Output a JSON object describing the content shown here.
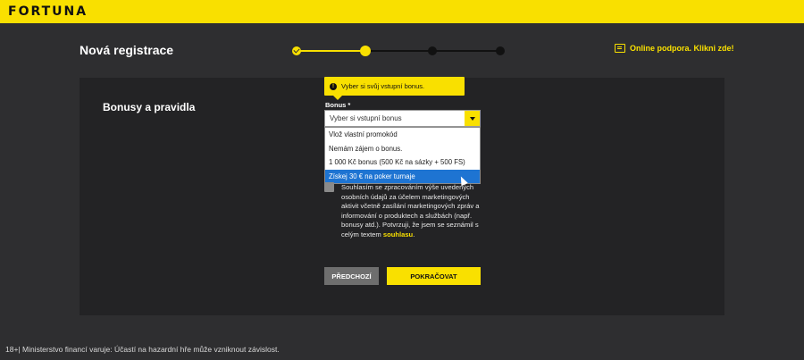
{
  "header": {
    "logo": "FORTUNA"
  },
  "page": {
    "title": "Nová registrace"
  },
  "stepper": {
    "total_steps": 4,
    "completed_steps": 1,
    "current_step": 2
  },
  "support": {
    "label": "Online podpora. Klikni zde!",
    "icon": "chat-icon"
  },
  "section": {
    "title": "Bonusy a pravidla"
  },
  "tooltip": {
    "text": "Vyber si svůj vstupní bonus.",
    "icon": "info-icon"
  },
  "bonus": {
    "label": "Bonus *",
    "selected": "Vyber si vstupní bonus",
    "options": [
      "Vlož vlastní promokód",
      "Nemám zájem o bonus.",
      "1 000 Kč bonus (500 Kč na sázky + 500 FS)",
      "Získej 30 € na poker turnaje"
    ],
    "highlighted_option": "Získej 30 € na poker turnaje"
  },
  "consent": {
    "text": "Souhlasím se zpracováním výše uvedených osobních údajů za účelem marketingových aktivit včetně zasílání marketingových zpráv a informování o produktech a službách (např. bonusy atd.). Potvrzuji, že jsem se seznámil s celým textem",
    "link": "souhlasu",
    "suffix": ".",
    "checked": false
  },
  "buttons": {
    "back": "PŘEDCHOZÍ",
    "next": "POKRAČOVAT"
  },
  "footer": {
    "text": "18+| Ministerstvo financí varuje: Účastí na hazardní hře může vzniknout závislost."
  },
  "colors": {
    "brand": "#f9e000",
    "background": "#2e2e30",
    "panel": "#232325",
    "highlight": "#1e74d2"
  }
}
